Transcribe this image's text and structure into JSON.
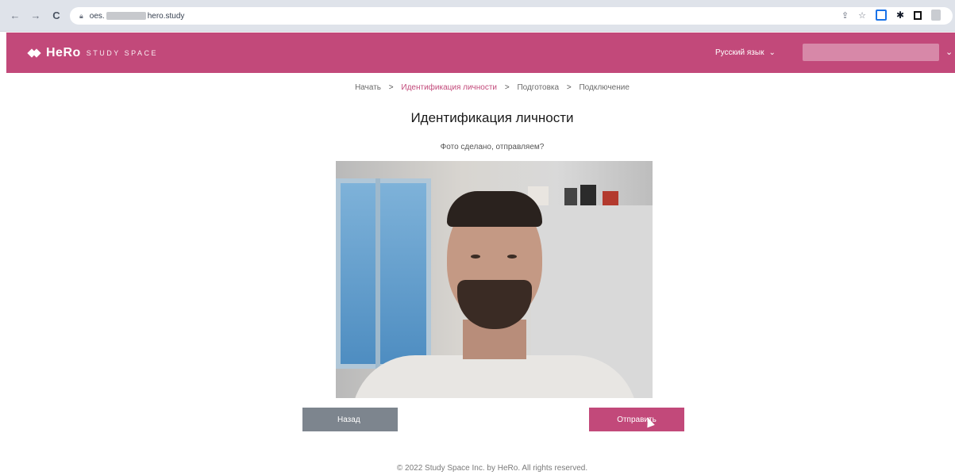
{
  "browser": {
    "url_prefix": "oes.",
    "url_suffix": "hero.study"
  },
  "header": {
    "brand_name": "HeRo",
    "brand_sub": "STUDY SPACE",
    "language": "Русский язык",
    "accent_color": "#c2497a"
  },
  "breadcrumb": {
    "items": [
      "Начать",
      "Идентификация личности",
      "Подготовка",
      "Подключение"
    ],
    "separator": ">"
  },
  "main": {
    "title": "Идентификация личности",
    "subtitle": "Фото сделано, отправляем?"
  },
  "actions": {
    "back_label": "Назад",
    "send_label": "Отправить"
  },
  "footer": {
    "copyright": "© 2022 Study Space Inc. by HeRo. All rights reserved."
  }
}
